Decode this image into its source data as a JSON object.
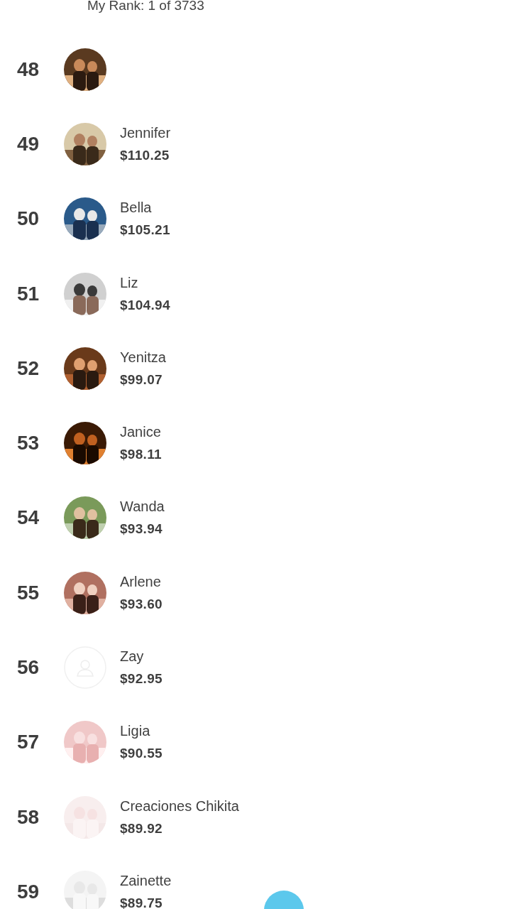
{
  "header": {
    "rank_text": "My Rank: 1 of 3733"
  },
  "leaderboard": [
    {
      "rank": "48"
    },
    {
      "rank": "49",
      "name": "Jennifer",
      "amount": "$110.25"
    },
    {
      "rank": "50",
      "name": "Bella",
      "amount": "$105.21"
    },
    {
      "rank": "51",
      "name": "Liz",
      "amount": "$104.94"
    },
    {
      "rank": "52",
      "name": "Yenitza",
      "amount": "$99.07"
    },
    {
      "rank": "53",
      "name": "Janice",
      "amount": "$98.11"
    },
    {
      "rank": "54",
      "name": "Wanda",
      "amount": "$93.94"
    },
    {
      "rank": "55",
      "name": "Arlene",
      "amount": "$93.60"
    },
    {
      "rank": "56",
      "name": "Zay",
      "amount": "$92.95",
      "avatar": {
        "kind": "placeholder"
      }
    },
    {
      "rank": "57",
      "name": "Ligia",
      "amount": "$90.55"
    },
    {
      "rank": "58",
      "name": "Creaciones Chikita",
      "amount": "$89.92"
    },
    {
      "rank": "59",
      "name": "Zainette",
      "amount": "$89.75"
    }
  ]
}
